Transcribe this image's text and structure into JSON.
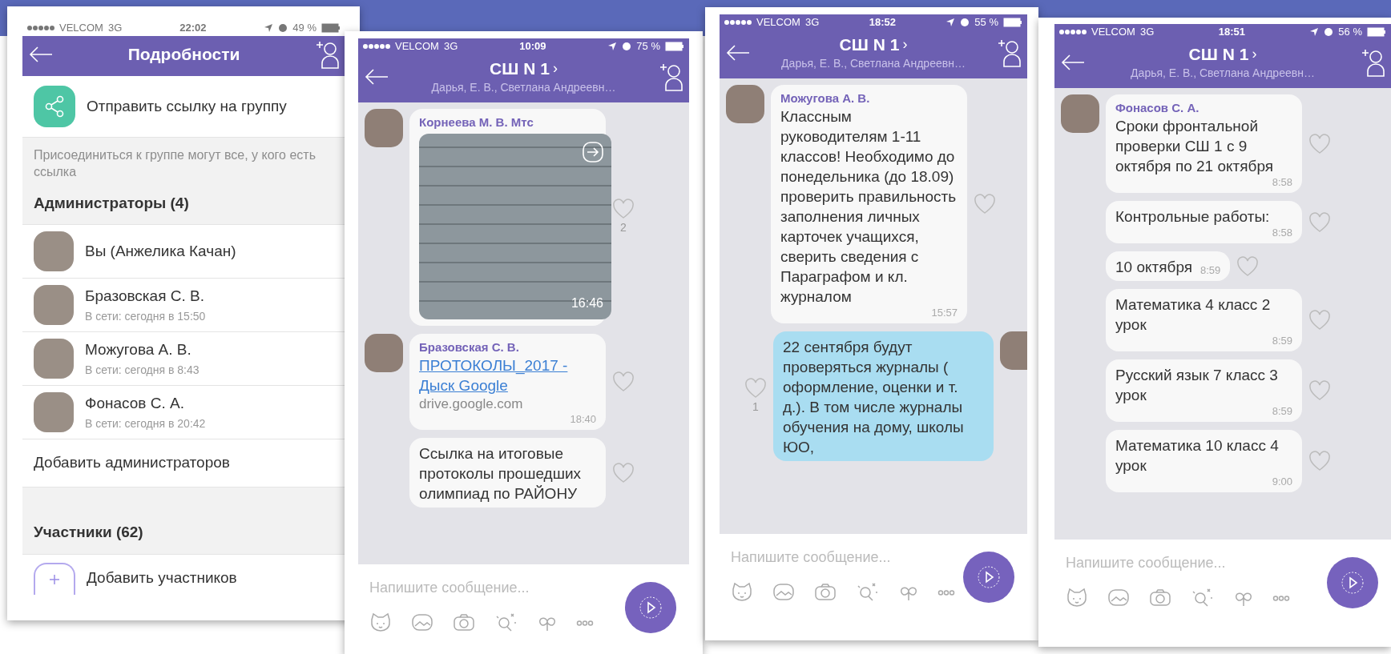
{
  "screens": [
    {
      "kind": "details",
      "status": {
        "carrier": "VELCOM",
        "network": "3G",
        "time": "22:02",
        "battery": "49 %"
      },
      "title": "Подробности",
      "share_label": "Отправить ссылку на группу",
      "share_note": "Присоединиться к группе могут все, у кого есть ссылка",
      "admins_heading": "Администраторы (4)",
      "admins": [
        {
          "name": "Вы (Анжелика Качан)"
        },
        {
          "name": "Бразовская С. В.",
          "last_seen": "В сети: сегодня в 15:50"
        },
        {
          "name": "Можугова А. В.",
          "last_seen": "В сети: сегодня в 8:43"
        },
        {
          "name": "Фонасов С. А.",
          "last_seen": "В сети: сегодня в 20:42"
        }
      ],
      "add_admins": "Добавить администраторов",
      "members_heading": "Участники (62)",
      "add_members": "Добавить участников"
    },
    {
      "kind": "chat",
      "status": {
        "carrier": "VELCOM",
        "network": "3G",
        "time": "10:09",
        "battery": "75 %"
      },
      "title": "СШ N 1",
      "title_chevron": "›",
      "subtitle": "Дарья, Е. В., Светлана Андреевн…",
      "messages": [
        {
          "kind": "image",
          "sender": "Корнеева М. В. Мтс",
          "time": "16:46",
          "likes": "2"
        },
        {
          "kind": "link",
          "sender": "Бразовская С. В.",
          "link": "ПРОТОКОЛЫ_2017 - Дыск Google",
          "domain": "drive.google.com",
          "time": "18:40"
        },
        {
          "kind": "text",
          "text": "Ссылка на итоговые протоколы прошедших олимпиад по РАЙОНУ"
        }
      ],
      "composer_placeholder": "Напишите сообщение..."
    },
    {
      "kind": "chat",
      "status": {
        "carrier": "VELCOM",
        "network": "3G",
        "time": "18:52",
        "battery": "55 %"
      },
      "title": "СШ N 1",
      "title_chevron": "›",
      "subtitle": "Дарья, Е. В., Светлана Андреевн…",
      "messages": [
        {
          "kind": "text",
          "sender": "Можугова А. В.",
          "text": "Классным руководителям 1-11 классов! Необходимо до понедельника (до 18.09) проверить правильность заполнения личных карточек учащихся, сверить сведения с Параграфом и кл. журналом",
          "time": "15:57"
        },
        {
          "kind": "outgoing",
          "text": "22 сентября будут проверяться журналы ( оформление, оценки и т. д.). В том числе журналы обучения на дому, школы ЮО,",
          "likes": "1"
        }
      ],
      "composer_placeholder": "Напишите сообщение..."
    },
    {
      "kind": "chat",
      "status": {
        "carrier": "VELCOM",
        "network": "3G",
        "time": "18:51",
        "battery": "56 %"
      },
      "title": "СШ N 1",
      "title_chevron": "›",
      "subtitle": "Дарья, Е. В., Светлана Андреевн…",
      "messages": [
        {
          "kind": "text",
          "sender": "Фонасов С. А.",
          "text": "Сроки фронтальной проверки СШ 1  с 9 октября по 21 октября",
          "time": "8:58"
        },
        {
          "kind": "text",
          "text": "Контрольные работы:",
          "time": "8:58"
        },
        {
          "kind": "text",
          "text": "10 октября",
          "time": "8:59"
        },
        {
          "kind": "text",
          "text": "Математика 4 класс 2 урок",
          "time": "8:59"
        },
        {
          "kind": "text",
          "text": "Русский язык 7 класс 3 урок",
          "time": "8:59"
        },
        {
          "kind": "text",
          "text": "Математика 10 класс 4 урок",
          "time": "9:00"
        }
      ],
      "composer_placeholder": "Напишите сообщение..."
    }
  ]
}
